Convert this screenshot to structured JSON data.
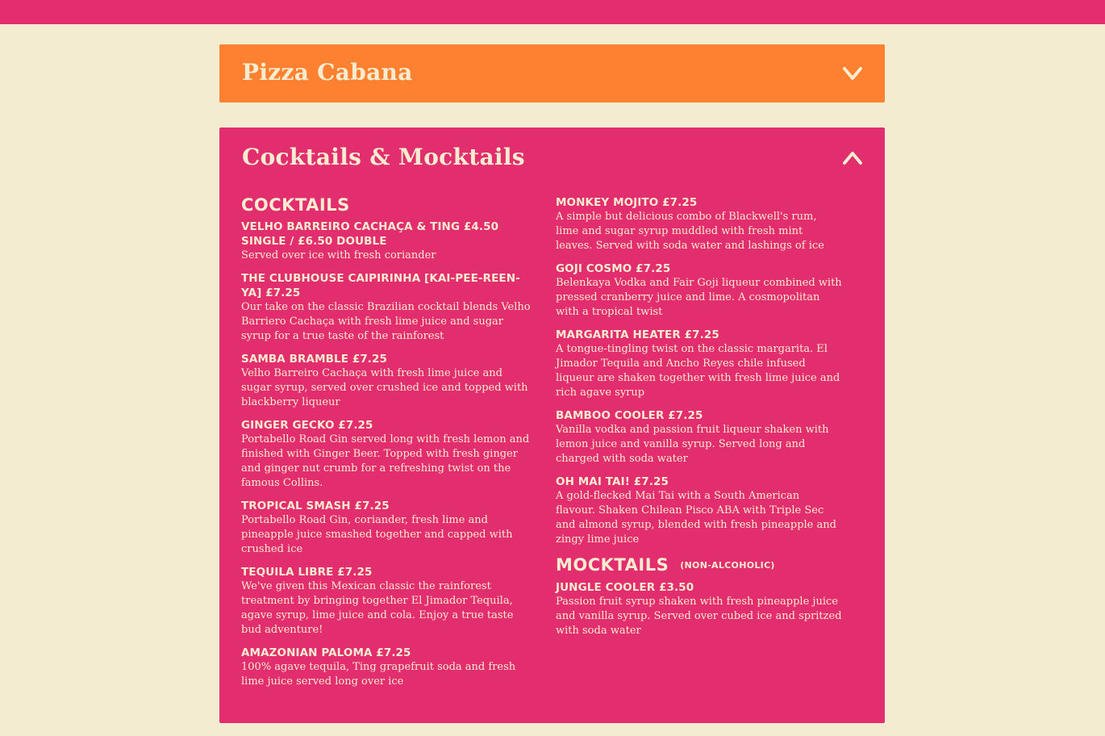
{
  "header": {
    "bar_color": "#e22d6e"
  },
  "accordion": [
    {
      "title": "Pizza Cabana",
      "color": "#fe8031",
      "state": "collapsed",
      "icon": "chevron-down-icon"
    },
    {
      "title": "Cocktails & Mocktails",
      "color": "#e22d6e",
      "state": "expanded",
      "icon": "chevron-up-icon"
    }
  ],
  "menu": {
    "cocktails_heading": "Cocktails",
    "mocktails_heading": "Mocktails",
    "mocktails_note": "(Non-Alcoholic)",
    "left_items": [
      {
        "name": "Velho Barreiro Cachaça & Ting £4.50 Single / £6.50 Double",
        "desc": "Served over ice with fresh coriander"
      },
      {
        "name": "The Clubhouse Caipirinha [Kai-pee-reen-ya] £7.25",
        "desc": "Our take on the classic Brazilian cocktail blends Velho Barriero Cachaça with fresh lime juice and sugar syrup for a true taste of the rainforest"
      },
      {
        "name": "Samba Bramble £7.25",
        "desc": "Velho Barreiro Cachaça with fresh lime juice and sugar syrup, served over crushed ice and topped with blackberry liqueur"
      },
      {
        "name": "Ginger Gecko £7.25",
        "desc": "Portabello Road Gin served long with fresh lemon and finished with Ginger Beer. Topped with fresh ginger and ginger nut crumb for a refreshing twist on the famous Collins."
      },
      {
        "name": "Tropical Smash £7.25",
        "desc": "Portabello Road Gin, coriander, fresh lime and pineapple juice smashed together and capped with crushed ice"
      },
      {
        "name": "Tequila Libre £7.25",
        "desc": "We've given this Mexican classic the rainforest treatment by bringing together El Jimador Tequila, agave syrup, lime juice and cola. Enjoy a true taste bud adventure!"
      },
      {
        "name": "Amazonian Paloma £7.25",
        "desc": "100% agave tequila, Ting grapefruit soda and fresh lime juice served long over ice"
      }
    ],
    "right_items": [
      {
        "name": "Monkey Mojito £7.25",
        "desc": "A simple but delicious combo of Blackwell's rum, lime and sugar syrup muddled with fresh mint leaves. Served with soda water and lashings of ice"
      },
      {
        "name": "Goji Cosmo £7.25",
        "desc": "Belenkaya Vodka and Fair Goji liqueur combined with pressed cranberry juice and lime. A cosmopolitan with a tropical twist"
      },
      {
        "name": "Margarita Heater £7.25",
        "desc": "A tongue-tingling twist on the classic margarita. El Jimador Tequila and Ancho Reyes chile infused liqueur are shaken together with fresh lime juice and rich agave syrup"
      },
      {
        "name": "Bamboo Cooler £7.25",
        "desc": "Vanilla vodka and passion fruit liqueur shaken with lemon juice and vanilla syrup. Served long and charged with soda water"
      },
      {
        "name": "Oh Mai Tai! £7.25",
        "desc": "A gold-flecked Mai Tai with a South American flavour. Shaken Chilean Pisco ABA with Triple Sec and almond syrup, blended with fresh pineapple and zingy lime juice"
      }
    ],
    "mocktail_items": [
      {
        "name": "Jungle Cooler £3.50",
        "desc": "Passion fruit syrup shaken with fresh pineapple juice and vanilla syrup. Served over cubed ice and spritzed with soda water"
      }
    ]
  }
}
